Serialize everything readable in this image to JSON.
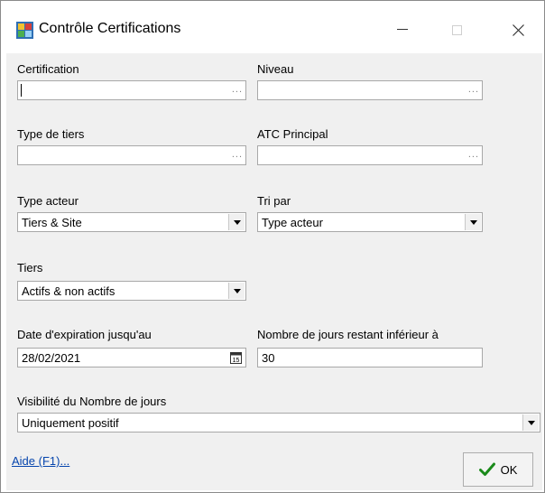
{
  "window": {
    "title": "Contrôle Certifications"
  },
  "titlebar": {
    "minimize_icon": "minimize-icon",
    "maximize_icon": "maximize-icon",
    "close_icon": "close-icon"
  },
  "form": {
    "certification": {
      "label": "Certification",
      "value": "",
      "browse": "..."
    },
    "niveau": {
      "label": "Niveau",
      "value": "",
      "browse": "..."
    },
    "type_tiers": {
      "label": "Type de tiers",
      "value": "",
      "browse": "..."
    },
    "atc_principal": {
      "label": "ATC Principal",
      "value": "",
      "browse": "..."
    },
    "type_acteur": {
      "label": "Type acteur",
      "value": "Tiers & Site"
    },
    "tri_par": {
      "label": "Tri par",
      "value": "Type acteur"
    },
    "tiers": {
      "label": "Tiers",
      "value": "Actifs & non actifs"
    },
    "date_expiration": {
      "label": "Date d'expiration jusqu'au",
      "value": "28/02/2021",
      "icon": "calendar-icon"
    },
    "nb_jours": {
      "label": "Nombre de jours restant inférieur à",
      "value": "30"
    },
    "visibilite": {
      "label": "Visibilité du Nombre de jours",
      "value": "Uniquement positif"
    }
  },
  "footer": {
    "help_link": "Aide (F1)...",
    "ok_label": "OK",
    "ok_icon": "checkmark-icon"
  },
  "colors": {
    "accent_green": "#1a8a1a",
    "link": "#0645ad",
    "dialog_bg": "#f0f0f0"
  }
}
